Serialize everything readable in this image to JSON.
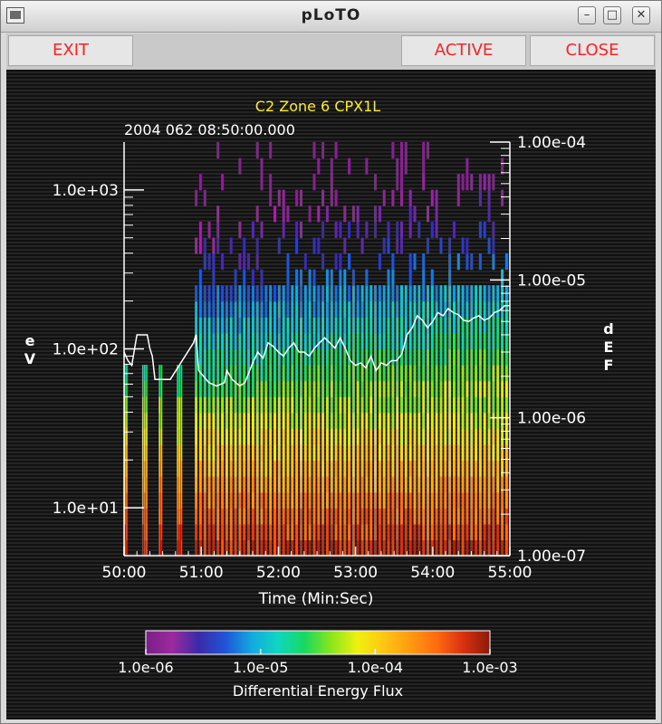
{
  "window": {
    "title": "pLoTO"
  },
  "toolbar": {
    "exit_label": "EXIT",
    "active_label": "ACTIVE",
    "close_label": "CLOSE"
  },
  "chart_data": {
    "type": "heatmap",
    "title": "C2 Zone 6 CPX1L",
    "subtitle": "2004 062 08:50:00.000",
    "xlabel": "Time (Min:Sec)",
    "ylabel_left": "eV",
    "ylabel_right": "dEF",
    "x_ticks": [
      "50:00",
      "51:00",
      "52:00",
      "53:00",
      "54:00",
      "55:00"
    ],
    "xlim_seconds": [
      0,
      300
    ],
    "y_left_ticks": [
      "1.0e+03",
      "1.0e+02",
      "1.0e+01"
    ],
    "y_left_range_eV": [
      5,
      2000
    ],
    "y_left_scale": "log",
    "y_right_ticks": [
      "1.00e-04",
      "1.00e-05",
      "1.00e-06",
      "1.00e-07"
    ],
    "y_right_range": [
      1e-07,
      0.0001
    ],
    "y_right_scale": "log",
    "colorbar": {
      "label": "Differential Energy Flux",
      "ticks": [
        "1.0e-06",
        "1.0e-05",
        "1.0e-04",
        "1.0e-03"
      ],
      "range": [
        1e-06,
        0.001
      ],
      "scale": "log",
      "colors": [
        "#7a1e88",
        "#9c2a9e",
        "#3a2aa8",
        "#1f55d6",
        "#12a9e0",
        "#10d6c0",
        "#18d860",
        "#8ae61a",
        "#f0f010",
        "#ffc514",
        "#ff9a10",
        "#ff6a10",
        "#d83010",
        "#8c1a0a"
      ]
    },
    "line_series": {
      "name": "dEF",
      "axis": "right",
      "points": [
        [
          0,
          3e-06
        ],
        [
          3,
          2.6e-06
        ],
        [
          6,
          2.4e-06
        ],
        [
          10,
          4e-06
        ],
        [
          14,
          4e-06
        ],
        [
          18,
          4e-06
        ],
        [
          20,
          3.2e-06
        ],
        [
          22,
          2.8e-06
        ],
        [
          24,
          1.9e-06
        ],
        [
          36,
          1.9e-06
        ],
        [
          54,
          3.5e-06
        ],
        [
          56,
          4e-06
        ],
        [
          58,
          2.2e-06
        ],
        [
          66,
          1.8e-06
        ],
        [
          72,
          1.7e-06
        ],
        [
          78,
          1.8e-06
        ],
        [
          80,
          2.2e-06
        ],
        [
          84,
          1.9e-06
        ],
        [
          90,
          1.7e-06
        ],
        [
          94,
          1.8e-06
        ],
        [
          100,
          2.5e-06
        ],
        [
          104,
          3e-06
        ],
        [
          108,
          2.7e-06
        ],
        [
          112,
          3.5e-06
        ],
        [
          116,
          3.3e-06
        ],
        [
          120,
          3e-06
        ],
        [
          124,
          2.8e-06
        ],
        [
          128,
          3.2e-06
        ],
        [
          132,
          3.5e-06
        ],
        [
          136,
          3e-06
        ],
        [
          140,
          3e-06
        ],
        [
          144,
          2.8e-06
        ],
        [
          148,
          3.2e-06
        ],
        [
          152,
          3.5e-06
        ],
        [
          156,
          3.8e-06
        ],
        [
          160,
          3.5e-06
        ],
        [
          164,
          3.2e-06
        ],
        [
          168,
          3.8e-06
        ],
        [
          172,
          3.2e-06
        ],
        [
          176,
          2.6e-06
        ],
        [
          180,
          2.4e-06
        ],
        [
          184,
          2.5e-06
        ],
        [
          188,
          2.3e-06
        ],
        [
          192,
          2.8e-06
        ],
        [
          196,
          2.2e-06
        ],
        [
          200,
          2.5e-06
        ],
        [
          204,
          2.4e-06
        ],
        [
          208,
          2.6e-06
        ],
        [
          212,
          2.6e-06
        ],
        [
          216,
          2.9e-06
        ],
        [
          220,
          4e-06
        ],
        [
          224,
          4.5e-06
        ],
        [
          228,
          5.5e-06
        ],
        [
          232,
          5.1e-06
        ],
        [
          236,
          4.5e-06
        ],
        [
          240,
          5e-06
        ],
        [
          244,
          5.8e-06
        ],
        [
          248,
          5.5e-06
        ],
        [
          252,
          6.2e-06
        ],
        [
          256,
          5.8e-06
        ],
        [
          260,
          5.6e-06
        ],
        [
          264,
          5.1e-06
        ],
        [
          268,
          5e-06
        ],
        [
          272,
          5.3e-06
        ],
        [
          276,
          5.5e-06
        ],
        [
          280,
          5.1e-06
        ],
        [
          284,
          5.3e-06
        ],
        [
          288,
          5.8e-06
        ],
        [
          292,
          6e-06
        ],
        [
          296,
          6.5e-06
        ],
        [
          300,
          6.5e-06
        ]
      ]
    }
  }
}
